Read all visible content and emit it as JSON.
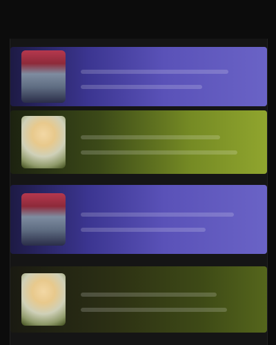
{
  "header": {
    "title": ""
  },
  "cards": [
    {
      "title": "",
      "subtitle": "",
      "style": "purple",
      "avatar": "warrior-portrait"
    },
    {
      "title": "",
      "subtitle": "",
      "style": "olive",
      "avatar": "healer-portrait"
    },
    {
      "title": "",
      "subtitle": "",
      "style": "purple",
      "avatar": "warrior-portrait"
    },
    {
      "title": "",
      "subtitle": "",
      "style": "dark",
      "avatar": "healer-portrait"
    }
  ],
  "colors": {
    "background": "#0c0c0c",
    "purple_accent": "#5a52b8",
    "olive_accent": "#758a24"
  }
}
